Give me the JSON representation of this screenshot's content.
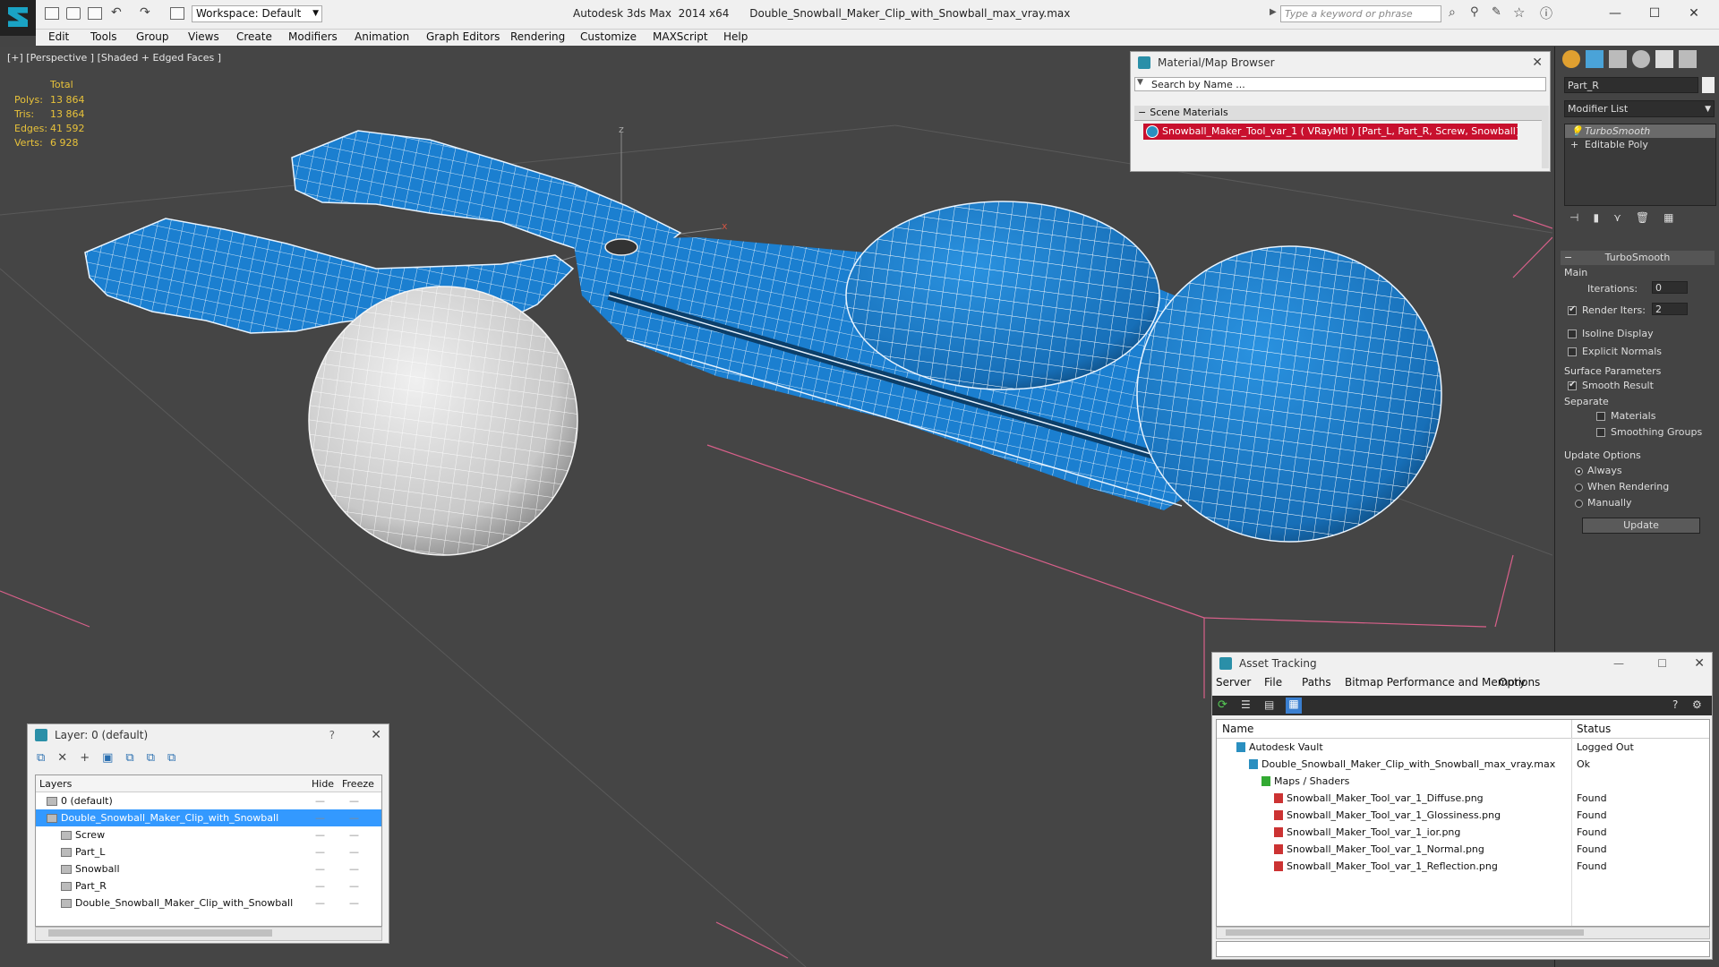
{
  "window": {
    "workspace_label": "Workspace: Default",
    "app_title": "Autodesk 3ds Max  2014 x64      Double_Snowball_Maker_Clip_with_Snowball_max_vray.max",
    "search_placeholder": "Type a keyword or phrase",
    "controls": {
      "minimize": "—",
      "maximize": "☐",
      "close": "✕"
    }
  },
  "menu": [
    "Edit",
    "Tools",
    "Group",
    "Views",
    "Create",
    "Modifiers",
    "Animation",
    "Graph Editors",
    "Rendering",
    "Customize",
    "MAXScript",
    "Help"
  ],
  "viewport": {
    "label": "[+] [Perspective ] [Shaded + Edged Faces ]",
    "stats_header": "Total",
    "stats": [
      {
        "key": "Polys:",
        "value": "13 864"
      },
      {
        "key": "Tris:",
        "value": "13 864"
      },
      {
        "key": "Edges:",
        "value": "41 592"
      },
      {
        "key": "Verts:",
        "value": "6 928"
      }
    ],
    "axis_z": "z",
    "axis_x": "x"
  },
  "material_browser": {
    "title": "Material/Map Browser",
    "search_placeholder": "Search by Name ...",
    "section": "Scene Materials",
    "material": "Snowball_Maker_Tool_var_1  ( VRayMtl ) [Part_L, Part_R, Screw, Snowball]"
  },
  "command_panel": {
    "object_name": "Part_R",
    "modifier_list_label": "Modifier List",
    "stack": [
      "TurboSmooth",
      "Editable Poly"
    ],
    "rollout_title": "TurboSmooth",
    "main_label": "Main",
    "iterations_label": "Iterations:",
    "iterations_value": "0",
    "render_iters_label": "Render Iters:",
    "render_iters_value": "2",
    "isoline_label": "Isoline Display",
    "explicit_normals_label": "Explicit Normals",
    "surface_params_label": "Surface Parameters",
    "smooth_result_label": "Smooth Result",
    "separate_label": "Separate",
    "materials_label": "Materials",
    "smoothing_groups_label": "Smoothing Groups",
    "update_options_label": "Update Options",
    "always_label": "Always",
    "when_rendering_label": "When Rendering",
    "manually_label": "Manually",
    "update_button": "Update",
    "render_iters_checked": true,
    "smooth_result_checked": true
  },
  "layer_panel": {
    "title": "Layer: 0 (default)",
    "help": "?",
    "columns": {
      "layers": "Layers",
      "hide": "Hide",
      "freeze": "Freeze"
    },
    "rows": [
      {
        "name": "0 (default)",
        "indent": 1
      },
      {
        "name": "Double_Snowball_Maker_Clip_with_Snowball",
        "indent": 1,
        "selected": true
      },
      {
        "name": "Screw",
        "indent": 2
      },
      {
        "name": "Part_L",
        "indent": 2
      },
      {
        "name": "Snowball",
        "indent": 2
      },
      {
        "name": "Part_R",
        "indent": 2
      },
      {
        "name": "Double_Snowball_Maker_Clip_with_Snowball",
        "indent": 2
      }
    ]
  },
  "asset_tracking": {
    "title": "Asset Tracking",
    "menu": [
      "Server",
      "File",
      "Paths",
      "Bitmap Performance and Memory",
      "Options"
    ],
    "columns": {
      "name": "Name",
      "status": "Status"
    },
    "rows": [
      {
        "name": "Autodesk Vault",
        "status": "Logged Out",
        "indent": 0
      },
      {
        "name": "Double_Snowball_Maker_Clip_with_Snowball_max_vray.max",
        "status": "Ok",
        "indent": 1
      },
      {
        "name": "Maps / Shaders",
        "status": "",
        "indent": 2
      },
      {
        "name": "Snowball_Maker_Tool_var_1_Diffuse.png",
        "status": "Found",
        "indent": 3
      },
      {
        "name": "Snowball_Maker_Tool_var_1_Glossiness.png",
        "status": "Found",
        "indent": 3
      },
      {
        "name": "Snowball_Maker_Tool_var_1_ior.png",
        "status": "Found",
        "indent": 3
      },
      {
        "name": "Snowball_Maker_Tool_var_1_Normal.png",
        "status": "Found",
        "indent": 3
      },
      {
        "name": "Snowball_Maker_Tool_var_1_Reflection.png",
        "status": "Found",
        "indent": 3
      }
    ]
  },
  "colors": {
    "model_blue": "#1b7fd0",
    "snowball_white": "#d9d9d9",
    "selection_blue": "#3399ff",
    "stats_yellow": "#e8c23a",
    "material_red": "#c8102e"
  }
}
